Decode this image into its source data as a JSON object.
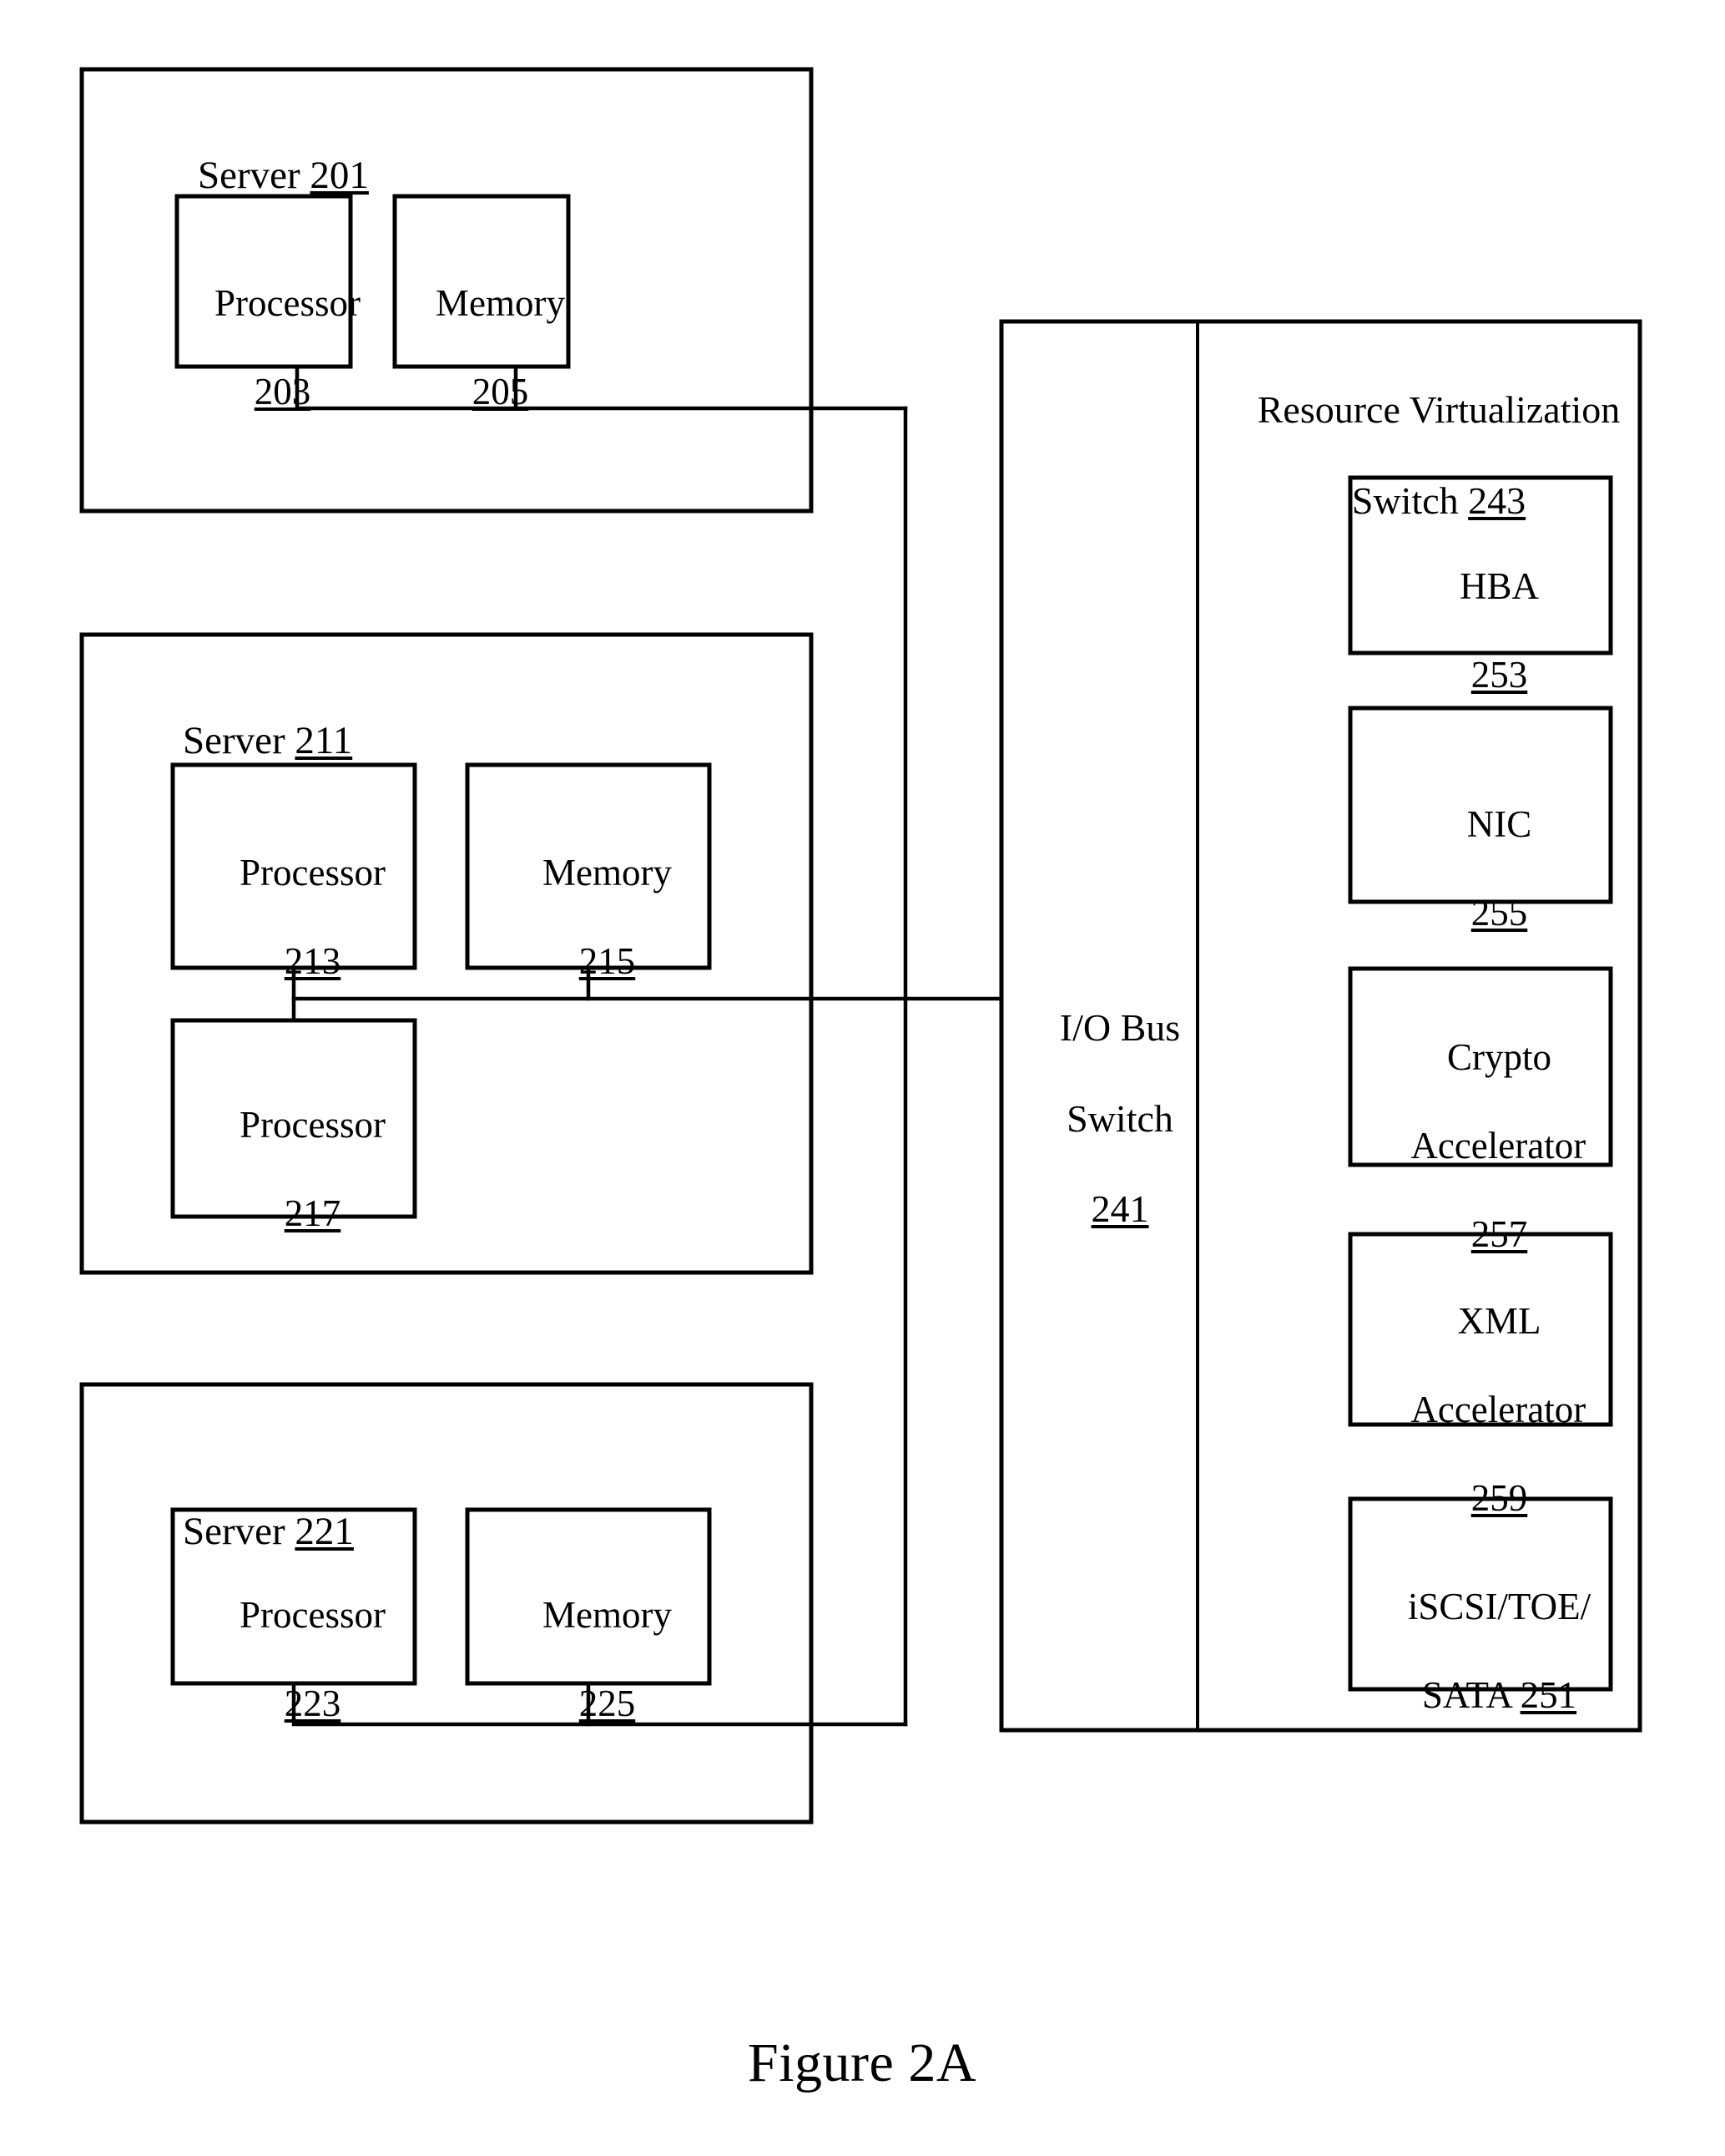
{
  "figure": {
    "caption": "Figure 2A"
  },
  "servers": [
    {
      "id": "server-201",
      "title_text": "Server ",
      "title_ref": "201",
      "components": [
        {
          "id": "processor-203",
          "name": "Processor",
          "ref": "203"
        },
        {
          "id": "memory-205",
          "name": "Memory",
          "ref": "205"
        }
      ]
    },
    {
      "id": "server-211",
      "title_text": "Server ",
      "title_ref": "211",
      "components": [
        {
          "id": "processor-213",
          "name": "Processor",
          "ref": "213"
        },
        {
          "id": "memory-215",
          "name": "Memory",
          "ref": "215"
        },
        {
          "id": "processor-217",
          "name": "Processor",
          "ref": "217"
        }
      ]
    },
    {
      "id": "server-221",
      "title_text": "Server ",
      "title_ref": "221",
      "components": [
        {
          "id": "processor-223",
          "name": "Processor",
          "ref": "223"
        },
        {
          "id": "memory-225",
          "name": "Memory",
          "ref": "225"
        }
      ]
    }
  ],
  "io_bus_switch": {
    "line1": "I/O Bus",
    "line2": "Switch",
    "ref": "241"
  },
  "resource_virtualization_switch": {
    "line1": "Resource Virtualization",
    "line2": "Switch ",
    "ref": "243",
    "resources": [
      {
        "id": "hba-253",
        "line1": "HBA",
        "line2": "",
        "ref": "253",
        "ref_inline": false
      },
      {
        "id": "nic-255",
        "line1": "NIC",
        "line2": "",
        "ref": "255",
        "ref_inline": false
      },
      {
        "id": "crypto-accelerator-257",
        "line1": "Crypto",
        "line2": "Accelerator",
        "ref": "257",
        "ref_inline": false
      },
      {
        "id": "xml-accelerator-259",
        "line1": "XML",
        "line2": "Accelerator",
        "ref": "259",
        "ref_inline": false
      },
      {
        "id": "iscsi-toe-sata-251",
        "line1": "iSCSI/TOE/",
        "line2": "SATA ",
        "ref": "251",
        "ref_inline": true
      }
    ]
  },
  "colors": {
    "stroke": "#000000",
    "background": "#ffffff"
  }
}
